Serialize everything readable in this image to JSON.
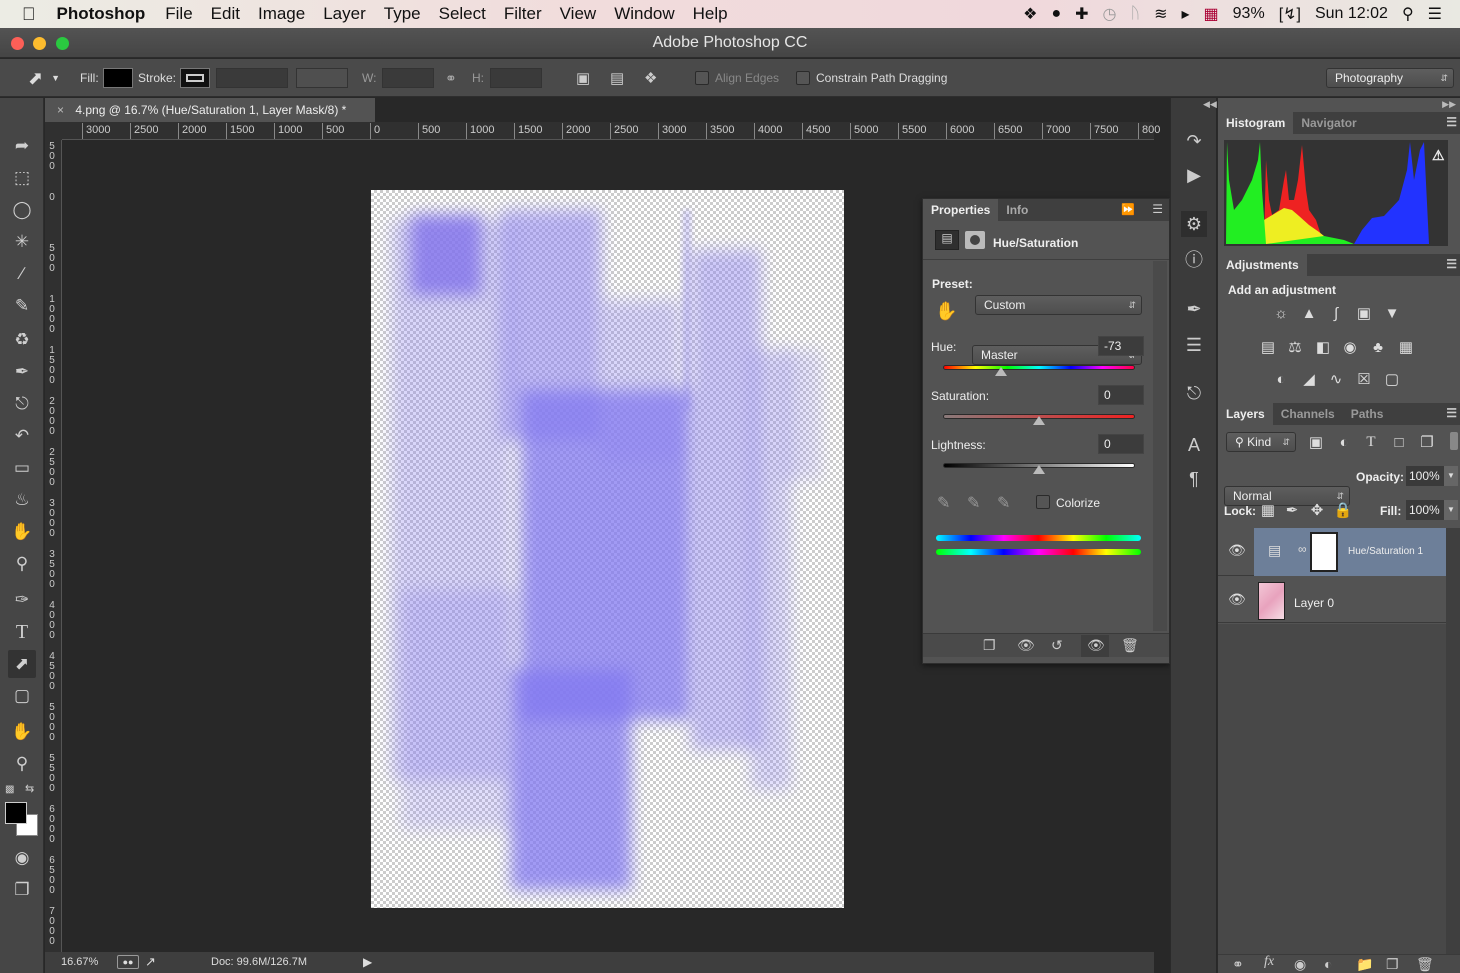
{
  "menubar": {
    "apple": "",
    "app": "Photoshop",
    "items": [
      "File",
      "Edit",
      "Image",
      "Layer",
      "Type",
      "Select",
      "Filter",
      "View",
      "Window",
      "Help"
    ],
    "battery": "93%",
    "clock": "Sun 12:02",
    "status_icons": [
      "dropbox-icon",
      "telegram-icon",
      "plus-icon",
      "time-machine-icon",
      "bluetooth-icon",
      "wifi-icon",
      "volume-icon",
      "uk-flag-icon",
      "battery-icon",
      "spotlight-icon",
      "notification-center-icon"
    ]
  },
  "window": {
    "title": "Adobe Photoshop CC"
  },
  "options": {
    "fill_label": "Fill:",
    "stroke_label": "Stroke:",
    "w_label": "W:",
    "h_label": "H:",
    "align_edges": "Align Edges",
    "constrain": "Constrain Path Dragging",
    "workspace": "Photography"
  },
  "document": {
    "tab": "4.png @ 16.7% (Hue/Saturation 1, Layer Mask/8) *",
    "close": "×",
    "ruler_h": [
      "3000",
      "2500",
      "2000",
      "1500",
      "1000",
      "500",
      "0",
      "500",
      "1000",
      "1500",
      "2000",
      "2500",
      "3000",
      "3500",
      "4000",
      "4500",
      "5000",
      "5500",
      "6000",
      "6500",
      "7000",
      "7500",
      "800"
    ],
    "ruler_v": [
      "5\n0\n0",
      "0",
      "5\n0\n0",
      "1\n0\n0\n0",
      "1\n5\n0\n0",
      "2\n0\n0\n0",
      "2\n5\n0\n0",
      "3\n0\n0\n0",
      "3\n5\n0\n0",
      "4\n0\n0\n0",
      "4\n5\n0\n0",
      "5\n0\n0\n0",
      "5\n5\n0\n0",
      "6\n0\n0\n0",
      "6\n5\n0\n0",
      "7\n0\n0\n0"
    ]
  },
  "status": {
    "zoom": "16.67%",
    "doc": "Doc: 99.6M/126.7M"
  },
  "properties": {
    "tabs": [
      "Properties",
      "Info"
    ],
    "title": "Hue/Saturation",
    "preset_label": "Preset:",
    "preset": "Custom",
    "channel": "Master",
    "hue_label": "Hue:",
    "hue": "-73",
    "hue_fraction": 0.3,
    "saturation_label": "Saturation:",
    "saturation": "0",
    "saturation_fraction": 0.5,
    "lightness_label": "Lightness:",
    "lightness": "0",
    "lightness_fraction": 0.5,
    "colorize": "Colorize"
  },
  "histogram": {
    "tabs": [
      "Histogram",
      "Navigator"
    ]
  },
  "adjustments": {
    "tab": "Adjustments",
    "subtitle": "Add an adjustment"
  },
  "layers": {
    "tabs": [
      "Layers",
      "Channels",
      "Paths"
    ],
    "filter": "Kind",
    "blend": "Normal",
    "opacity_label": "Opacity:",
    "opacity": "100%",
    "lock_label": "Lock:",
    "fill_label": "Fill:",
    "fill": "100%",
    "items": [
      {
        "name": "Hue/Saturation 1",
        "selected": true
      },
      {
        "name": "Layer 0",
        "selected": false
      }
    ]
  },
  "colors": {
    "accent_selected": "#6d7f99",
    "canvas_tint": "#8c82f0"
  }
}
